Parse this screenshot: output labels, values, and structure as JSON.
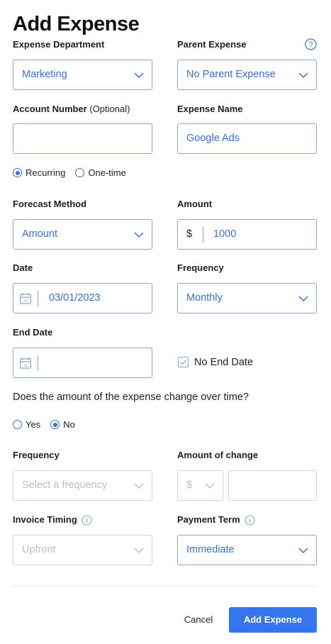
{
  "title": "Add Expense",
  "labels": {
    "department": "Expense Department",
    "parent": "Parent Expense",
    "account": "Account Number",
    "account_opt": "(Optional)",
    "name": "Expense Name",
    "forecast": "Forecast Method",
    "amount": "Amount",
    "date": "Date",
    "frequency": "Frequency",
    "end_date": "End Date",
    "change_frequency": "Frequency",
    "amount_change": "Amount of change",
    "invoice_timing": "Invoice Timing",
    "payment_term": "Payment Term"
  },
  "fields": {
    "department": "Marketing",
    "parent": "No Parent Expense",
    "account": "",
    "name": "Google Ads",
    "forecast": "Amount",
    "currency": "$",
    "amount": "1000",
    "date": "03/01/2023",
    "frequency": "Monthly",
    "end_date": "",
    "change_frequency_placeholder": "Select a frequency",
    "change_currency": "$",
    "change_amount": "",
    "invoice_timing": "Upfront",
    "payment_term": "Immediate"
  },
  "recurrence": {
    "options": [
      "Recurring",
      "One-time"
    ],
    "selected": "Recurring"
  },
  "no_end_date": {
    "label": "No End Date",
    "checked": true
  },
  "question": "Does the amount of the expense change over time?",
  "change_options": {
    "options": [
      "Yes",
      "No"
    ],
    "selected": "No"
  },
  "buttons": {
    "cancel": "Cancel",
    "submit": "Add Expense"
  },
  "colors": {
    "accent": "#3576f0",
    "field_text": "#3a6fd8",
    "field_border": "#8ca6cf",
    "disabled": "#b8bec8"
  }
}
